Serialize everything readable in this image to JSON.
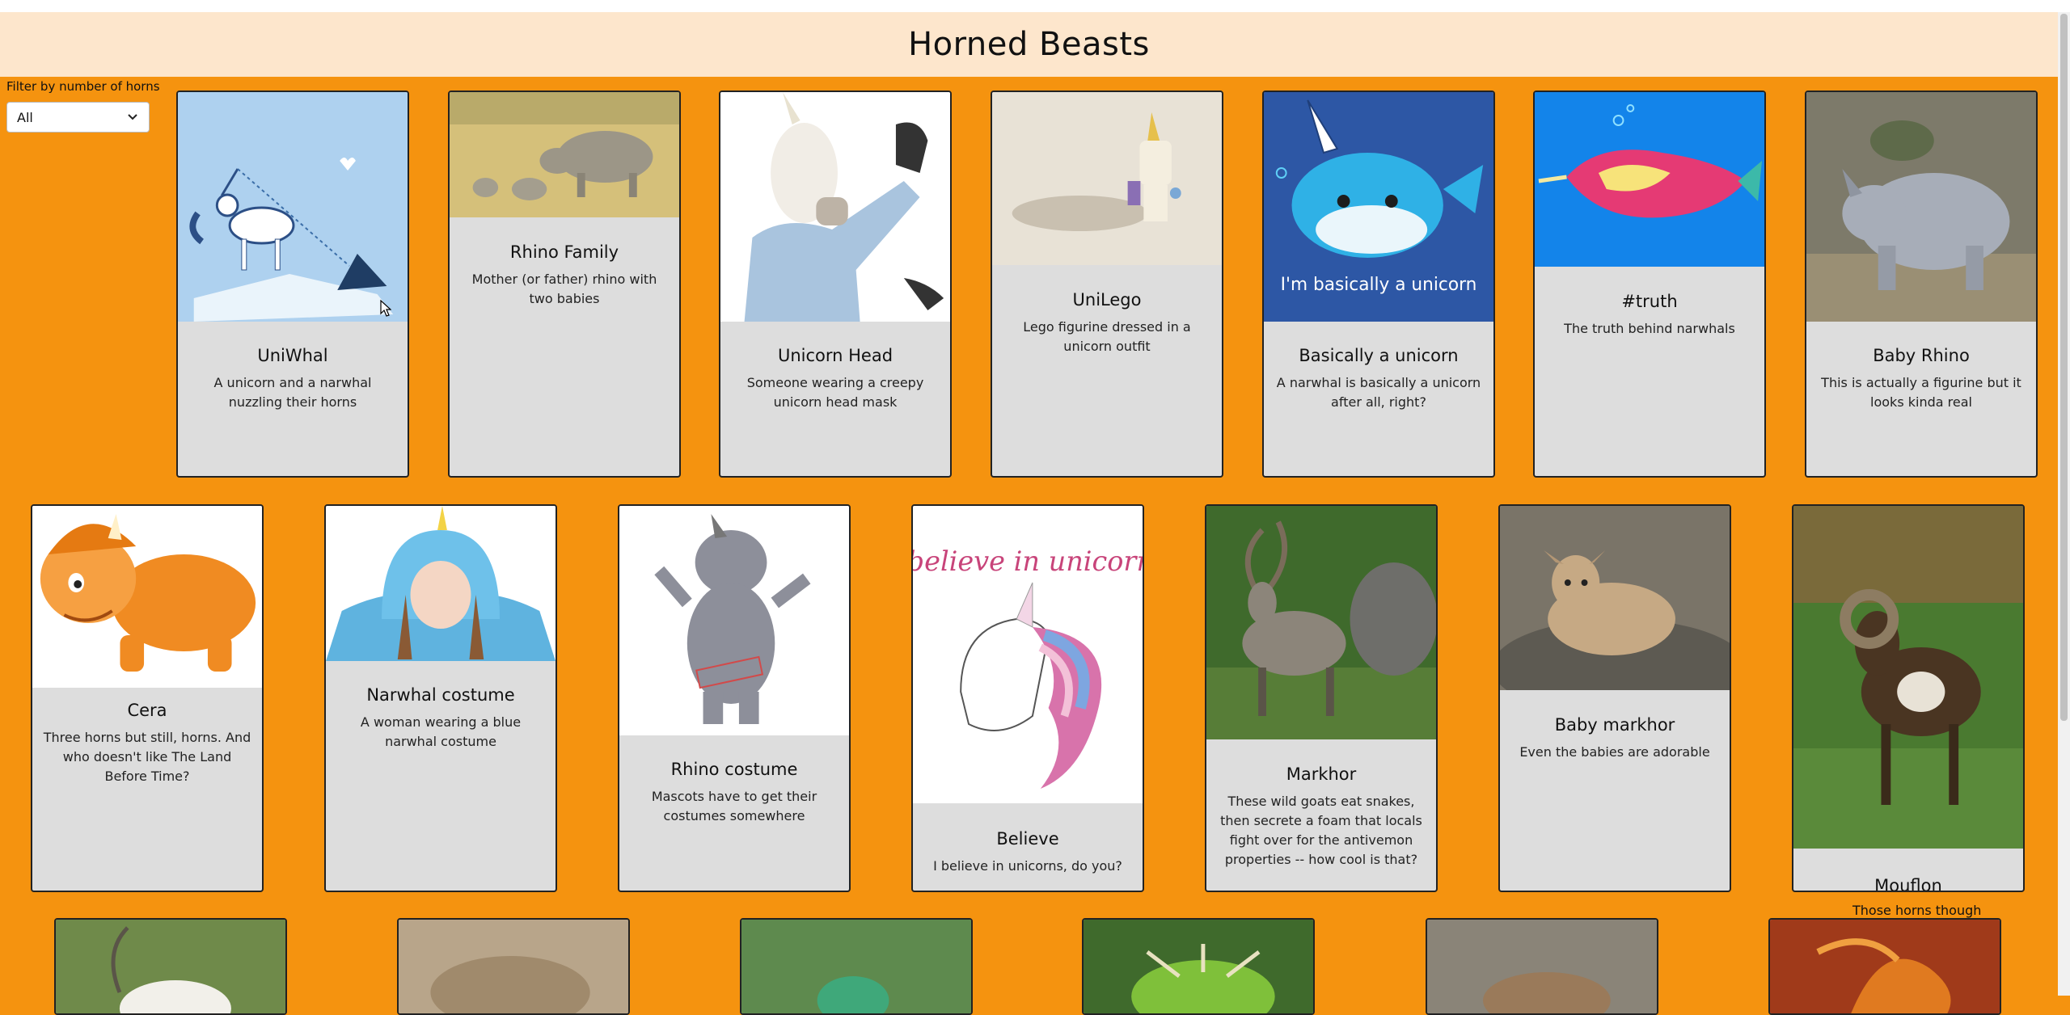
{
  "app": {
    "title": "Horned Beasts"
  },
  "filter": {
    "label": "Filter by number of horns",
    "selected": "All"
  },
  "beasts": [
    {
      "title": "UniWhal",
      "description": "A unicorn and a narwhal nuzzling their horns"
    },
    {
      "title": "Rhino Family",
      "description": "Mother (or father) rhino with two babies"
    },
    {
      "title": "Unicorn Head",
      "description": "Someone wearing a creepy unicorn head mask"
    },
    {
      "title": "UniLego",
      "description": "Lego figurine dressed in a unicorn outfit"
    },
    {
      "title": "Basically a unicorn",
      "description": "A narwhal is basically a unicorn after all, right?",
      "image_text": "I'm basically a unicorn"
    },
    {
      "title": "#truth",
      "description": "The truth behind narwhals"
    },
    {
      "title": "Baby Rhino",
      "description": "This is actually a figurine but it looks kinda real"
    },
    {
      "title": "Cera",
      "description": "Three horns but still, horns. And who doesn't like The Land Before Time?"
    },
    {
      "title": "Narwhal costume",
      "description": "A woman wearing a blue narwhal costume"
    },
    {
      "title": "Rhino costume",
      "description": "Mascots have to get their costumes somewhere"
    },
    {
      "title": "Believe",
      "description": "I believe in unicorns, do you?",
      "image_text": "I believe in unicorns"
    },
    {
      "title": "Markhor",
      "description": "These wild goats eat snakes, then secrete a foam that locals fight over for the antivemon properties -- how cool is that?"
    },
    {
      "title": "Baby markhor",
      "description": "Even the babies are adorable"
    },
    {
      "title": "Mouflon",
      "description": "Those horns though"
    }
  ],
  "colors": {
    "page_bg": "#f5930f",
    "header_bg": "#fde6cc",
    "card_bg": "#dddddd",
    "card_border": "#222222"
  }
}
